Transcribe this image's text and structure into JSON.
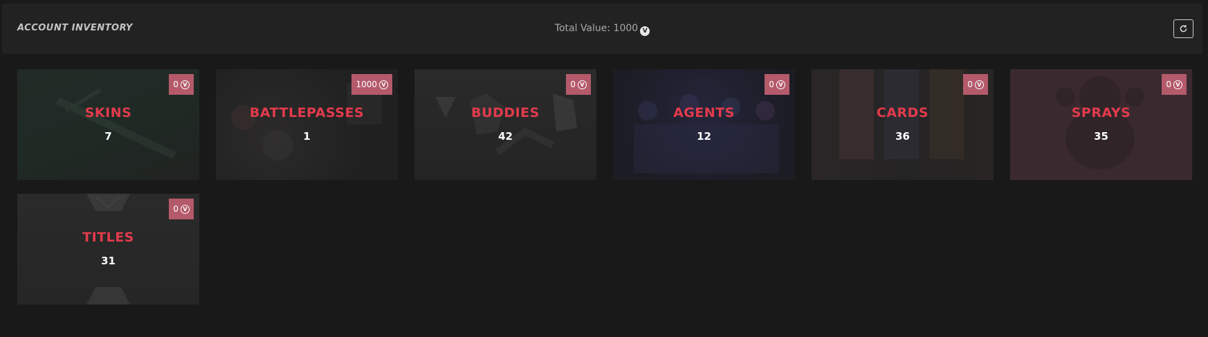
{
  "header": {
    "title": "ACCOUNT INVENTORY",
    "total_label": "Total Value: 1000"
  },
  "categories": [
    {
      "name": "SKINS",
      "count": "7",
      "value": "0",
      "bg": "skins"
    },
    {
      "name": "BATTLEPASSES",
      "count": "1",
      "value": "1000",
      "bg": "battlepasses"
    },
    {
      "name": "BUDDIES",
      "count": "42",
      "value": "0",
      "bg": "buddies"
    },
    {
      "name": "AGENTS",
      "count": "12",
      "value": "0",
      "bg": "agents"
    },
    {
      "name": "CARDS",
      "count": "36",
      "value": "0",
      "bg": "cards"
    },
    {
      "name": "SPRAYS",
      "count": "35",
      "value": "0",
      "bg": "sprays"
    },
    {
      "name": "TITLES",
      "count": "31",
      "value": "0",
      "bg": "titles"
    }
  ],
  "icons": {
    "currency": "valorant-points-icon",
    "refresh": "refresh-icon"
  },
  "colors": {
    "accent": "#e23b4c",
    "badge": "#b45a6b",
    "background": "#1a191a",
    "header": "#232223"
  }
}
